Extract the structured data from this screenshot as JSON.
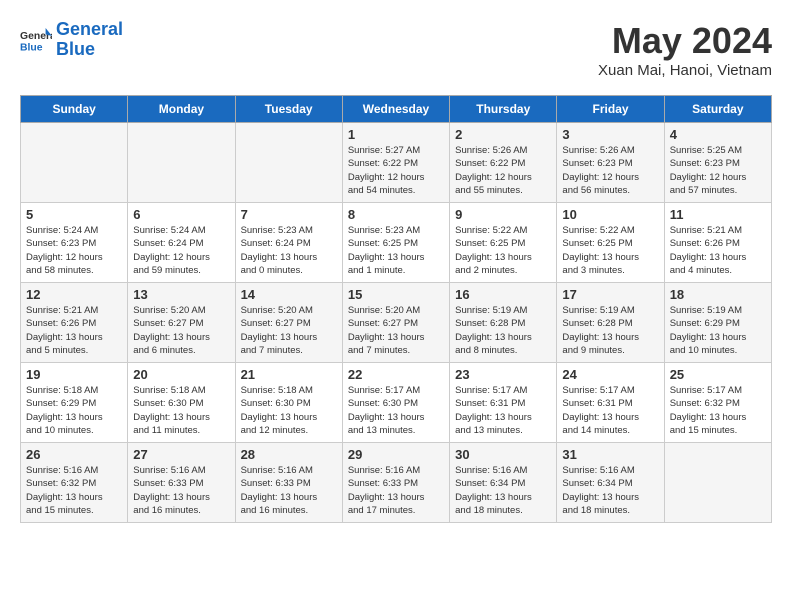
{
  "header": {
    "logo_line1": "General",
    "logo_line2": "Blue",
    "month_title": "May 2024",
    "location": "Xuan Mai, Hanoi, Vietnam"
  },
  "days_of_week": [
    "Sunday",
    "Monday",
    "Tuesday",
    "Wednesday",
    "Thursday",
    "Friday",
    "Saturday"
  ],
  "weeks": [
    [
      {
        "day": "",
        "info": ""
      },
      {
        "day": "",
        "info": ""
      },
      {
        "day": "",
        "info": ""
      },
      {
        "day": "1",
        "info": "Sunrise: 5:27 AM\nSunset: 6:22 PM\nDaylight: 12 hours\nand 54 minutes."
      },
      {
        "day": "2",
        "info": "Sunrise: 5:26 AM\nSunset: 6:22 PM\nDaylight: 12 hours\nand 55 minutes."
      },
      {
        "day": "3",
        "info": "Sunrise: 5:26 AM\nSunset: 6:23 PM\nDaylight: 12 hours\nand 56 minutes."
      },
      {
        "day": "4",
        "info": "Sunrise: 5:25 AM\nSunset: 6:23 PM\nDaylight: 12 hours\nand 57 minutes."
      }
    ],
    [
      {
        "day": "5",
        "info": "Sunrise: 5:24 AM\nSunset: 6:23 PM\nDaylight: 12 hours\nand 58 minutes."
      },
      {
        "day": "6",
        "info": "Sunrise: 5:24 AM\nSunset: 6:24 PM\nDaylight: 12 hours\nand 59 minutes."
      },
      {
        "day": "7",
        "info": "Sunrise: 5:23 AM\nSunset: 6:24 PM\nDaylight: 13 hours\nand 0 minutes."
      },
      {
        "day": "8",
        "info": "Sunrise: 5:23 AM\nSunset: 6:25 PM\nDaylight: 13 hours\nand 1 minute."
      },
      {
        "day": "9",
        "info": "Sunrise: 5:22 AM\nSunset: 6:25 PM\nDaylight: 13 hours\nand 2 minutes."
      },
      {
        "day": "10",
        "info": "Sunrise: 5:22 AM\nSunset: 6:25 PM\nDaylight: 13 hours\nand 3 minutes."
      },
      {
        "day": "11",
        "info": "Sunrise: 5:21 AM\nSunset: 6:26 PM\nDaylight: 13 hours\nand 4 minutes."
      }
    ],
    [
      {
        "day": "12",
        "info": "Sunrise: 5:21 AM\nSunset: 6:26 PM\nDaylight: 13 hours\nand 5 minutes."
      },
      {
        "day": "13",
        "info": "Sunrise: 5:20 AM\nSunset: 6:27 PM\nDaylight: 13 hours\nand 6 minutes."
      },
      {
        "day": "14",
        "info": "Sunrise: 5:20 AM\nSunset: 6:27 PM\nDaylight: 13 hours\nand 7 minutes."
      },
      {
        "day": "15",
        "info": "Sunrise: 5:20 AM\nSunset: 6:27 PM\nDaylight: 13 hours\nand 7 minutes."
      },
      {
        "day": "16",
        "info": "Sunrise: 5:19 AM\nSunset: 6:28 PM\nDaylight: 13 hours\nand 8 minutes."
      },
      {
        "day": "17",
        "info": "Sunrise: 5:19 AM\nSunset: 6:28 PM\nDaylight: 13 hours\nand 9 minutes."
      },
      {
        "day": "18",
        "info": "Sunrise: 5:19 AM\nSunset: 6:29 PM\nDaylight: 13 hours\nand 10 minutes."
      }
    ],
    [
      {
        "day": "19",
        "info": "Sunrise: 5:18 AM\nSunset: 6:29 PM\nDaylight: 13 hours\nand 10 minutes."
      },
      {
        "day": "20",
        "info": "Sunrise: 5:18 AM\nSunset: 6:30 PM\nDaylight: 13 hours\nand 11 minutes."
      },
      {
        "day": "21",
        "info": "Sunrise: 5:18 AM\nSunset: 6:30 PM\nDaylight: 13 hours\nand 12 minutes."
      },
      {
        "day": "22",
        "info": "Sunrise: 5:17 AM\nSunset: 6:30 PM\nDaylight: 13 hours\nand 13 minutes."
      },
      {
        "day": "23",
        "info": "Sunrise: 5:17 AM\nSunset: 6:31 PM\nDaylight: 13 hours\nand 13 minutes."
      },
      {
        "day": "24",
        "info": "Sunrise: 5:17 AM\nSunset: 6:31 PM\nDaylight: 13 hours\nand 14 minutes."
      },
      {
        "day": "25",
        "info": "Sunrise: 5:17 AM\nSunset: 6:32 PM\nDaylight: 13 hours\nand 15 minutes."
      }
    ],
    [
      {
        "day": "26",
        "info": "Sunrise: 5:16 AM\nSunset: 6:32 PM\nDaylight: 13 hours\nand 15 minutes."
      },
      {
        "day": "27",
        "info": "Sunrise: 5:16 AM\nSunset: 6:33 PM\nDaylight: 13 hours\nand 16 minutes."
      },
      {
        "day": "28",
        "info": "Sunrise: 5:16 AM\nSunset: 6:33 PM\nDaylight: 13 hours\nand 16 minutes."
      },
      {
        "day": "29",
        "info": "Sunrise: 5:16 AM\nSunset: 6:33 PM\nDaylight: 13 hours\nand 17 minutes."
      },
      {
        "day": "30",
        "info": "Sunrise: 5:16 AM\nSunset: 6:34 PM\nDaylight: 13 hours\nand 18 minutes."
      },
      {
        "day": "31",
        "info": "Sunrise: 5:16 AM\nSunset: 6:34 PM\nDaylight: 13 hours\nand 18 minutes."
      },
      {
        "day": "",
        "info": ""
      }
    ]
  ]
}
